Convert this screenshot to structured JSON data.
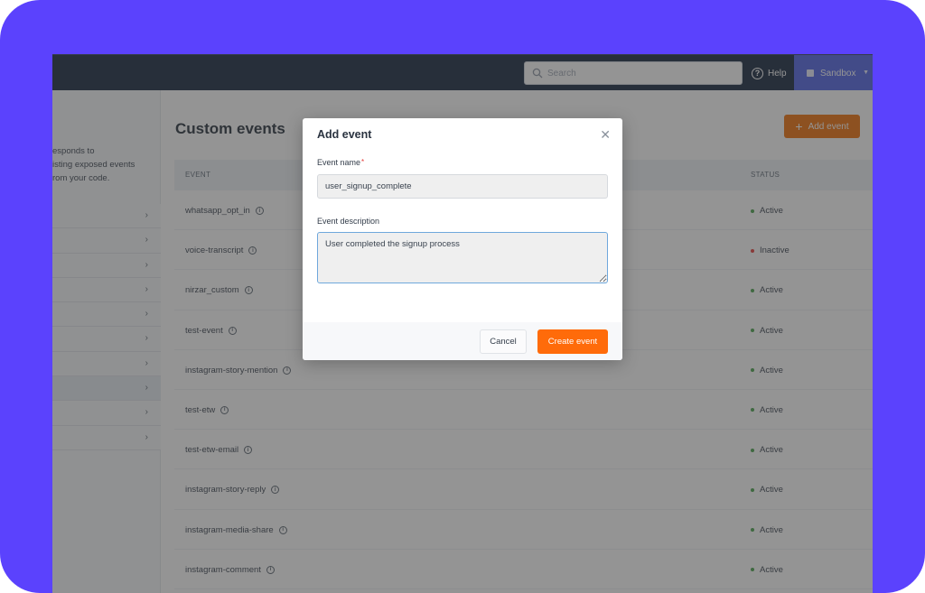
{
  "topbar": {
    "search_placeholder": "Search",
    "help_label": "Help",
    "workspace_label": "Sandbox"
  },
  "sidebar": {
    "description_lines": [
      "esponds to",
      "isting exposed events",
      "rom your code."
    ],
    "items_count": 10,
    "active_index": 7
  },
  "main": {
    "title": "Custom events",
    "add_button_label": "Add event",
    "columns": {
      "event": "EVENT",
      "status": "STATUS"
    },
    "rows": [
      {
        "event": "whatsapp_opt_in",
        "status": "Active"
      },
      {
        "event": "voice-transcript",
        "status": "Inactive"
      },
      {
        "event": "nirzar_custom",
        "status": "Active"
      },
      {
        "event": "test-event",
        "status": "Active"
      },
      {
        "event": "instagram-story-mention",
        "status": "Active"
      },
      {
        "event": "test-etw",
        "status": "Active"
      },
      {
        "event": "test-etw-email",
        "status": "Active"
      },
      {
        "event": "instagram-story-reply",
        "status": "Active"
      },
      {
        "event": "instagram-media-share",
        "status": "Active"
      },
      {
        "event": "instagram-comment",
        "status": "Active"
      }
    ]
  },
  "modal": {
    "title": "Add event",
    "name_label": "Event name",
    "required_mark": "*",
    "name_value": "user_signup_complete",
    "description_label": "Event description",
    "description_value": "User completed the signup process",
    "cancel_label": "Cancel",
    "create_label": "Create event"
  },
  "colors": {
    "frame": "#5b42fd",
    "topbar": "#0f1f38",
    "workspace": "#4b5ee4",
    "accent": "#ff6b0a",
    "active": "#43a047",
    "inactive": "#e53935"
  }
}
